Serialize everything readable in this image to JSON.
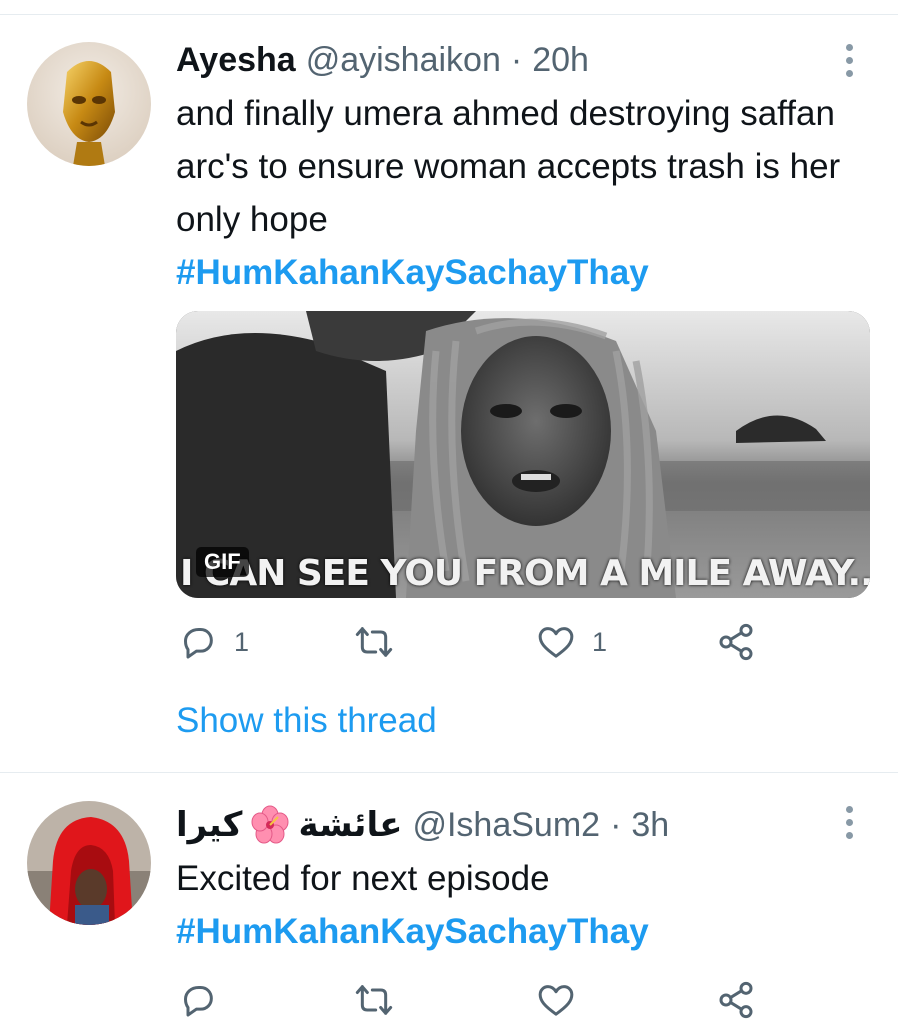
{
  "tweets": [
    {
      "display_name": "Ayesha",
      "handle": "@ayishaikon",
      "separator": "·",
      "time": "20h",
      "text": "and finally umera ahmed destroying saffan arc's to ensure woman accepts trash is her only hope",
      "hashtag": "#HumKahanKaySachayThay",
      "media": {
        "badge": "GIF",
        "caption": "I CAN SEE YOU FROM A MILE AWAY..."
      },
      "reply_count": "1",
      "retweet_count": "",
      "like_count": "1",
      "show_thread": "Show this thread"
    },
    {
      "display_name_part1": "كيرا",
      "display_name_emoji": "hibiscus-emoji",
      "display_name_part2": "عائشة",
      "handle": "@IshaSum2",
      "separator": "·",
      "time": "3h",
      "text": "Excited for next episode",
      "hashtag": "#HumKahanKaySachayThay",
      "reply_count": "",
      "retweet_count": "",
      "like_count": ""
    }
  ],
  "icons": {
    "reply": "reply-icon",
    "retweet": "retweet-icon",
    "like": "like-icon",
    "share": "share-icon",
    "more": "more-icon"
  },
  "colors": {
    "accent": "#1d9bf0",
    "muted": "#536471",
    "text": "#0f1419",
    "divider": "#e6ecf0"
  }
}
